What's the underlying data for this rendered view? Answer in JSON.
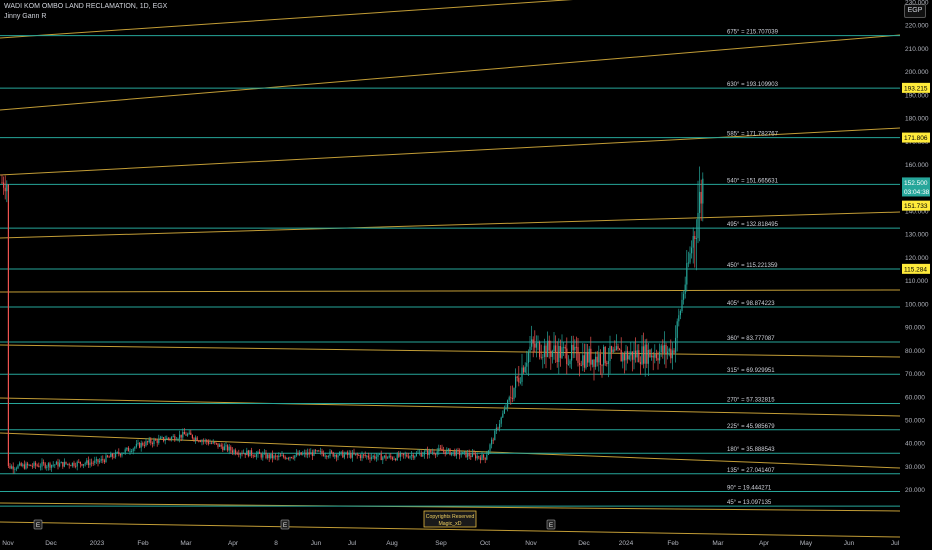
{
  "header": {
    "symbol": "WADI KOM OMBO LAND RECLAMATION, 1D, EGX",
    "indicator": "Jinny Gann R"
  },
  "currency_button": "EGP",
  "copyright": {
    "line1": "Copyrights Reserved",
    "line2": "Magic_xD"
  },
  "event_markers": [
    "E",
    "E",
    "E"
  ],
  "colors": {
    "background": "#000000",
    "level_line": "#26a69a",
    "fan_line": "#e5b940",
    "candle_up": "#26a69a",
    "candle_down": "#ef5350",
    "level_badge": "#ffeb3b",
    "price_badge": "#26a69a"
  },
  "chart_data": {
    "type": "candlestick",
    "title": "WADI KOM OMBO LAND RECLAMATION, 1D, EGX",
    "y_axis": {
      "ticks": [
        "230.000",
        "220.000",
        "210.000",
        "200.000",
        "190.000",
        "180.000",
        "170.000",
        "160.000",
        "150.000",
        "140.000",
        "130.000",
        "120.000",
        "110.000",
        "100.000",
        "90.000",
        "80.000",
        "70.000",
        "60.000",
        "50.000",
        "40.000",
        "30.000",
        "20.000"
      ],
      "range": [
        15,
        236
      ]
    },
    "x_axis": {
      "ticks": [
        "Nov",
        "Dec",
        "2023",
        "Feb",
        "Mar",
        "Apr",
        "8",
        "Jun",
        "Jul",
        "Aug",
        "Sep",
        "Oct",
        "Nov",
        "Dec",
        "2024",
        "Feb",
        "Mar",
        "Apr",
        "May",
        "Jun",
        "Jul"
      ]
    },
    "gann_levels": [
      {
        "label": "675° = 215.707039",
        "value": 215.707039
      },
      {
        "label": "630° = 193.109903",
        "value": 193.109903
      },
      {
        "label": "585° = 171.782767",
        "value": 171.782767
      },
      {
        "label": "540° = 151.665631",
        "value": 151.665631
      },
      {
        "label": "495° = 132.818495",
        "value": 132.818495
      },
      {
        "label": "450° = 115.221359",
        "value": 115.221359
      },
      {
        "label": "405° = 98.874223",
        "value": 98.874223
      },
      {
        "label": "360° = 83.777087",
        "value": 83.777087
      },
      {
        "label": "315° = 69.929951",
        "value": 69.929951
      },
      {
        "label": "270° = 57.332815",
        "value": 57.332815
      },
      {
        "label": "225° = 45.985679",
        "value": 45.985679
      },
      {
        "label": "180° = 35.888543",
        "value": 35.888543
      },
      {
        "label": "135° = 27.041407",
        "value": 27.041407
      },
      {
        "label": "90° = 19.444271",
        "value": 19.444271
      },
      {
        "label": "45° = 13.097135",
        "value": 13.097135
      }
    ],
    "price_badges": [
      {
        "label": "193.215",
        "value": 193.215,
        "kind": "level"
      },
      {
        "label": "171.806",
        "value": 171.806,
        "kind": "level"
      },
      {
        "label": "152.500",
        "value": 152.5,
        "kind": "price"
      },
      {
        "label": "03:04:38",
        "value": 148.6,
        "kind": "timer"
      },
      {
        "label": "151.733",
        "value": 142.5,
        "kind": "level"
      },
      {
        "label": "115.284",
        "value": 115.284,
        "kind": "level"
      }
    ],
    "price_path": [
      {
        "x": "Nov",
        "y": 30
      },
      {
        "x": "Dec",
        "y": 31
      },
      {
        "x": "2023",
        "y": 32
      },
      {
        "x": "Feb",
        "y": 40
      },
      {
        "x": "Mar",
        "y": 44
      },
      {
        "x": "Apr",
        "y": 37
      },
      {
        "x": "8",
        "y": 34
      },
      {
        "x": "Jun",
        "y": 36
      },
      {
        "x": "Jul",
        "y": 35
      },
      {
        "x": "Aug",
        "y": 34
      },
      {
        "x": "Sep",
        "y": 37
      },
      {
        "x": "Oct",
        "y": 34
      },
      {
        "x": "Nov",
        "y": 82
      },
      {
        "x": "Dec",
        "y": 77
      },
      {
        "x": "2024",
        "y": 78
      },
      {
        "x": "Feb",
        "y": 80
      },
      {
        "x": "Mar",
        "y": 152.5
      }
    ]
  }
}
